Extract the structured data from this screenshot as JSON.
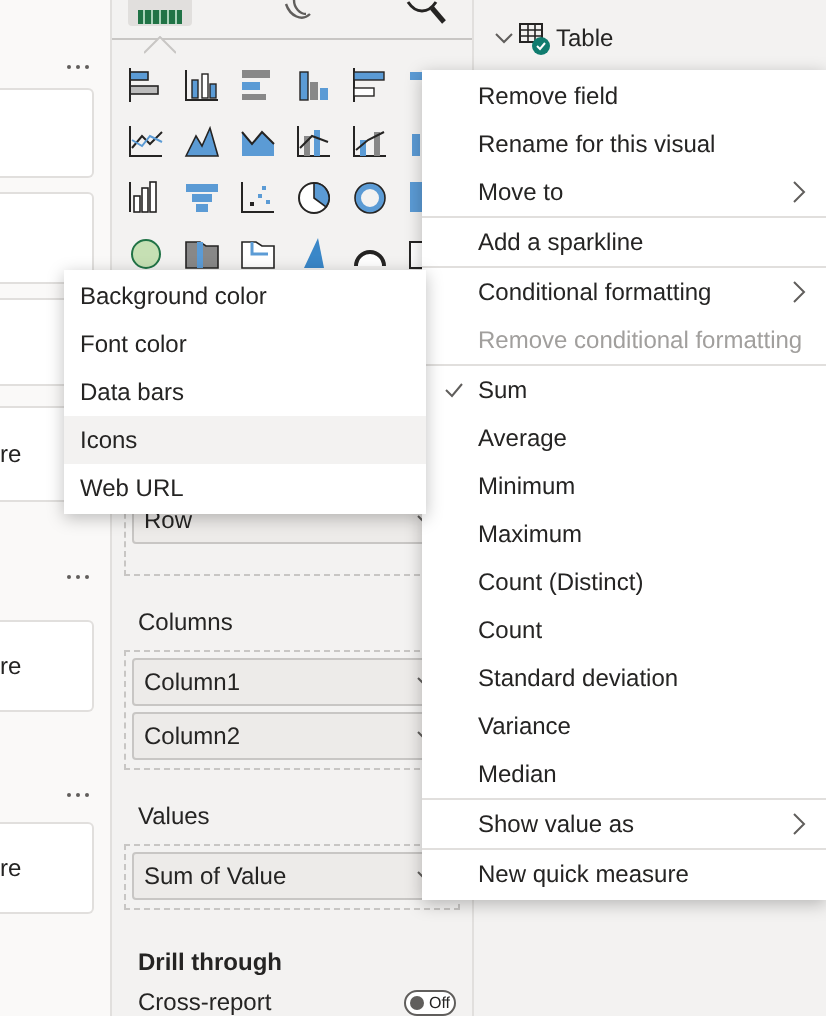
{
  "left_cards": [
    {
      "label": "re"
    },
    {
      "label": "re"
    },
    {
      "label": "re"
    }
  ],
  "field_header": {
    "label": "Table",
    "expanded": true
  },
  "field_wells": [
    {
      "fields": [
        "Row"
      ]
    },
    {
      "title": "Columns",
      "fields": [
        "Column1",
        "Column2"
      ]
    },
    {
      "title": "Values",
      "fields": [
        "Sum of Value"
      ]
    }
  ],
  "drill_through": {
    "title": "Drill through",
    "cross_report": {
      "label": "Cross-report",
      "on": false,
      "state_text": "Off"
    }
  },
  "context_menu": [
    {
      "label": "Remove field",
      "checked": false,
      "disabled": false,
      "submenu": false,
      "group_start": false
    },
    {
      "label": "Rename for this visual",
      "checked": false,
      "disabled": false,
      "submenu": false,
      "group_start": false
    },
    {
      "label": "Move to",
      "checked": false,
      "disabled": false,
      "submenu": true,
      "group_start": false
    },
    {
      "label": "Add a sparkline",
      "checked": false,
      "disabled": false,
      "submenu": false,
      "group_start": true
    },
    {
      "label": "Conditional formatting",
      "checked": false,
      "disabled": false,
      "submenu": true,
      "group_start": true
    },
    {
      "label": "Remove conditional formatting",
      "checked": false,
      "disabled": true,
      "submenu": false,
      "group_start": false
    },
    {
      "label": "Sum",
      "checked": true,
      "disabled": false,
      "submenu": false,
      "group_start": true
    },
    {
      "label": "Average",
      "checked": false,
      "disabled": false,
      "submenu": false,
      "group_start": false
    },
    {
      "label": "Minimum",
      "checked": false,
      "disabled": false,
      "submenu": false,
      "group_start": false
    },
    {
      "label": "Maximum",
      "checked": false,
      "disabled": false,
      "submenu": false,
      "group_start": false
    },
    {
      "label": "Count (Distinct)",
      "checked": false,
      "disabled": false,
      "submenu": false,
      "group_start": false
    },
    {
      "label": "Count",
      "checked": false,
      "disabled": false,
      "submenu": false,
      "group_start": false
    },
    {
      "label": "Standard deviation",
      "checked": false,
      "disabled": false,
      "submenu": false,
      "group_start": false
    },
    {
      "label": "Variance",
      "checked": false,
      "disabled": false,
      "submenu": false,
      "group_start": false
    },
    {
      "label": "Median",
      "checked": false,
      "disabled": false,
      "submenu": false,
      "group_start": false
    },
    {
      "label": "Show value as",
      "checked": false,
      "disabled": false,
      "submenu": true,
      "group_start": true
    },
    {
      "label": "New quick measure",
      "checked": false,
      "disabled": false,
      "submenu": false,
      "group_start": true
    }
  ],
  "conditional_formatting_menu": [
    {
      "label": "Background color",
      "selected": false
    },
    {
      "label": "Font color",
      "selected": false
    },
    {
      "label": "Data bars",
      "selected": false
    },
    {
      "label": "Icons",
      "selected": true
    },
    {
      "label": "Web URL",
      "selected": false
    }
  ]
}
